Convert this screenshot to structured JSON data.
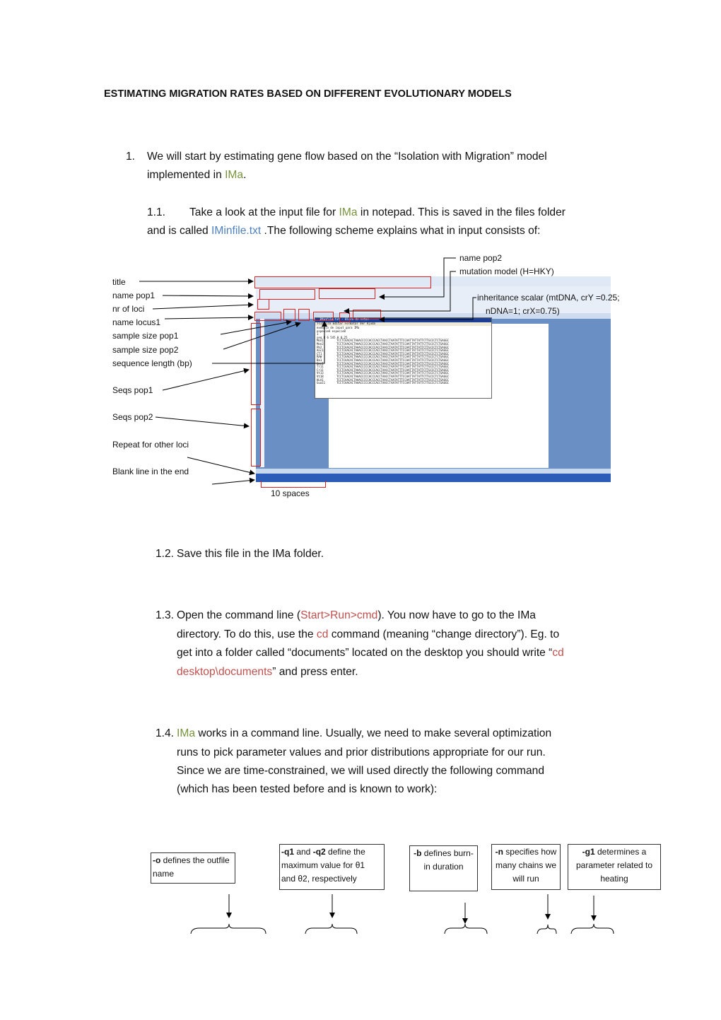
{
  "title": "ESTIMATING MIGRATION RATES BASED ON DIFFERENT EVOLUTIONARY MODELS",
  "s1": {
    "num": "1.",
    "l1": "We will start by estimating gene flow based on the “Isolation with Migration” model",
    "l2a": "implemented in ",
    "ima": "IMa",
    "l2b": "."
  },
  "s11": {
    "num": "1.1.",
    "l1a": "Take a look at the input file for ",
    "ima": "IMa",
    "l1b": " in notepad. This is saved in the files folder",
    "l2a": "and is called ",
    "file": "IMinfile.txt",
    "l2b": " .The following scheme explains what in input consists of:"
  },
  "figure": {
    "labels": {
      "title": "title",
      "name_pop1": "name pop1",
      "nr_loci": "nr of loci",
      "name_locus1": "name locus1",
      "ss_pop1": "sample size pop1",
      "ss_pop2": "sample size pop2",
      "seq_len": "sequence length (bp)",
      "seqs_pop1": "Seqs pop1",
      "seqs_pop2": "Seqs pop2",
      "repeat": "Repeat for other loci",
      "blank": "Blank line in the end",
      "name_pop2": "name pop2",
      "mut_model": "mutation model (H=HKY)",
      "inh1": "inheritance scalar (mtDNA, crY =0.25;",
      "inh2": "nDNA=1; crX=0.75)",
      "spaces": "10 spaces"
    },
    "notepad": {
      "title": "IMinfile.txt - Bloco de notas",
      "menu": "Ficheiro  Editar  Formatar  Ver  Ajuda",
      "lines": [
        "exemplo de input para IMa",
        "especieA especieB",
        "1",
        "seq 8 6 545 H 0.25"
      ],
      "names": [
        "Mon1",
        "Mon2",
        "Pb2",
        "Anc1",
        "CT1",
        "RAW",
        "Ba1",
        "Gen1",
        "Tr11",
        "Cr11",
        "Vt13",
        "Vt18",
        "HLA1",
        "Gua11"
      ],
      "seq": "TCCTCAACACTAAACCCCCACCCACCTAACCTAATATTTCCAATTATTATTCTTGCCCTCTGAGGC"
    }
  },
  "s12": {
    "num": "1.2.",
    "text": "Save this file in the IMa folder."
  },
  "s13": {
    "num": "1.3.",
    "l1a": "Open the command line (",
    "cmd": "Start>Run>cmd",
    "l1b": "). You now have to go to the IMa",
    "l2a": "directory. To do this, use the ",
    "cd": "cd",
    "l2b": " command (meaning “change directory”). Eg. to",
    "l3a": "get into a folder called “documents” located on the desktop you should write “",
    "cd2": "cd",
    "l4a": "desktop\\documents",
    "l4b": "” and press enter."
  },
  "s14": {
    "num": "1.4.",
    "ima": "IMa",
    "l1": " works in a command line. Usually, we need to make several optimization",
    "l2": "runs to pick parameter values and prior distributions appropriate for our run.",
    "l3": "Since we are time-constrained, we will used directly the following command",
    "l4": "(which has been tested before and is known to work):"
  },
  "boxes": [
    {
      "flag": "-o",
      "rest1": " defines the outfile",
      "rest2": "name"
    },
    {
      "flag": "-q1",
      "mid": " and ",
      "flag2": "-q2",
      "rest1": " define the",
      "rest2": "maximum value for θ1",
      "rest3": "and θ2, respectively"
    },
    {
      "flag": "-b",
      "rest1": " defines burn-",
      "rest2": "in duration"
    },
    {
      "flag": "-n",
      "rest1": " specifies how",
      "rest2": "many chains we",
      "rest3": "will run"
    },
    {
      "flag": "-g1",
      "rest1": " determines a",
      "rest2": "parameter related to",
      "rest3": "heating"
    }
  ],
  "colors": {
    "ima": "#77933C",
    "file": "#4F81BD",
    "command": "#C0504D",
    "annotation_box": "#E02020"
  }
}
